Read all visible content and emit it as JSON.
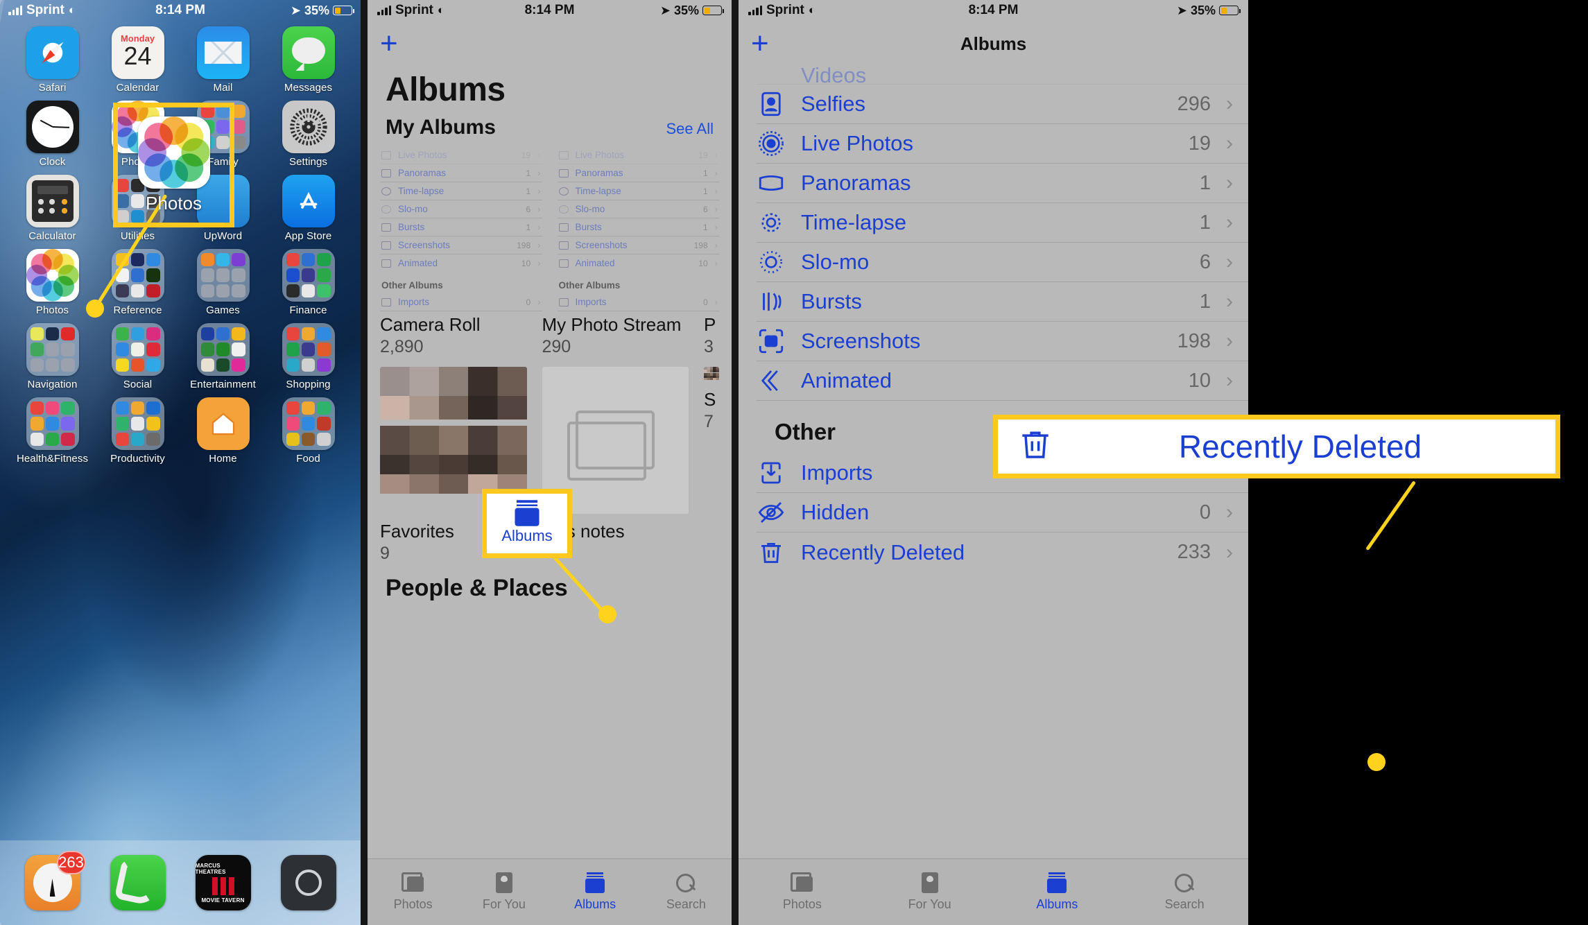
{
  "panel1": {
    "status": {
      "carrier": "Sprint",
      "time": "8:14 PM",
      "battery": "35%"
    },
    "apps": [
      {
        "label": "Safari",
        "icon": "safari-icon"
      },
      {
        "label": "Calendar",
        "icon": "calendar-icon",
        "weekday": "Monday",
        "day": "24"
      },
      {
        "label": "Mail",
        "icon": "mail-icon"
      },
      {
        "label": "Messages",
        "icon": "messages-icon"
      },
      {
        "label": "Clock",
        "icon": "clock-icon"
      },
      {
        "label": "Photos",
        "icon": "photos-icon"
      },
      {
        "label": "Family",
        "icon": "folder-icon"
      },
      {
        "label": "Settings",
        "icon": "settings-gear-icon"
      },
      {
        "label": "Calculator",
        "icon": "calculator-icon"
      },
      {
        "label": "Utilities",
        "icon": "folder-icon"
      },
      {
        "label": "UpWord",
        "icon": "upword-icon"
      },
      {
        "label": "App Store",
        "icon": "app-store-icon"
      },
      {
        "label": "Photos",
        "icon": "photos-icon"
      },
      {
        "label": "Reference",
        "icon": "folder-icon"
      },
      {
        "label": "Games",
        "icon": "folder-icon"
      },
      {
        "label": "Finance",
        "icon": "folder-icon"
      },
      {
        "label": "Navigation",
        "icon": "folder-icon"
      },
      {
        "label": "Social",
        "icon": "folder-icon"
      },
      {
        "label": "Entertainment",
        "icon": "folder-icon"
      },
      {
        "label": "Shopping",
        "icon": "folder-icon"
      },
      {
        "label": "Health&Fitness",
        "icon": "folder-icon"
      },
      {
        "label": "Productivity",
        "icon": "folder-icon"
      },
      {
        "label": "Home",
        "icon": "home-icon"
      },
      {
        "label": "Food",
        "icon": "folder-icon"
      }
    ],
    "dock": [
      {
        "label": "Podcasts",
        "icon": "podcast-icon",
        "badge": "263"
      },
      {
        "label": "Phone",
        "icon": "phone-icon"
      },
      {
        "label": "Marcus Theatres",
        "icon": "marcus-theatres-icon",
        "line1": "MARCUS THEATRES",
        "line2": "MOVIE TAVERN"
      },
      {
        "label": "Camera",
        "icon": "camera-icon"
      }
    ],
    "callout": {
      "label": "Photos"
    }
  },
  "panel2": {
    "status": {
      "carrier": "Sprint",
      "time": "8:14 PM",
      "battery": "35%"
    },
    "nav": {
      "add_label": "+"
    },
    "title": "Albums",
    "section": {
      "heading": "My Albums",
      "see_all": "See All"
    },
    "mock_rows": [
      {
        "name": "Live Photos",
        "count": "19"
      },
      {
        "name": "Panoramas",
        "count": "1"
      },
      {
        "name": "Time-lapse",
        "count": "1"
      },
      {
        "name": "Slo-mo",
        "count": "6"
      },
      {
        "name": "Bursts",
        "count": "1"
      },
      {
        "name": "Screenshots",
        "count": "198"
      },
      {
        "name": "Animated",
        "count": "10"
      }
    ],
    "other_albums_heading": "Other Albums",
    "imports_row": {
      "name": "Imports",
      "count": "0"
    },
    "cards": [
      {
        "title": "Camera Roll",
        "count": "2,890",
        "thumb": "mosaic"
      },
      {
        "title": "My Photo Stream",
        "count": "290",
        "thumb": "empty"
      },
      {
        "title": "P",
        "count": "3",
        "thumb": "mosaic"
      }
    ],
    "cards_row2": [
      {
        "title": "Favorites",
        "count": "9"
      },
      {
        "title": "tor's notes",
        "count": ""
      },
      {
        "title": "S",
        "count": "7"
      }
    ],
    "people_places": "People & Places",
    "tabs": [
      {
        "label": "Photos",
        "icon": "photos-stack-icon",
        "active": false
      },
      {
        "label": "For You",
        "icon": "for-you-icon",
        "active": false
      },
      {
        "label": "Albums",
        "icon": "albums-icon",
        "active": true
      },
      {
        "label": "Search",
        "icon": "search-icon",
        "active": false
      }
    ],
    "callout": {
      "label": "Albums"
    }
  },
  "panel3": {
    "status": {
      "carrier": "Sprint",
      "time": "8:14 PM",
      "battery": "35%"
    },
    "nav": {
      "add_label": "+",
      "title": "Albums"
    },
    "partial_row": {
      "name": "Videos"
    },
    "rows": [
      {
        "name": "Selfies",
        "count": "296",
        "icon": "selfies-icon"
      },
      {
        "name": "Live Photos",
        "count": "19",
        "icon": "live-photos-icon"
      },
      {
        "name": "Panoramas",
        "count": "1",
        "icon": "panoramas-icon"
      },
      {
        "name": "Time-lapse",
        "count": "1",
        "icon": "time-lapse-icon"
      },
      {
        "name": "Slo-mo",
        "count": "6",
        "icon": "slo-mo-icon"
      },
      {
        "name": "Bursts",
        "count": "1",
        "icon": "bursts-icon"
      },
      {
        "name": "Screenshots",
        "count": "198",
        "icon": "screenshots-icon"
      },
      {
        "name": "Animated",
        "count": "10",
        "icon": "animated-icon"
      }
    ],
    "other_heading": "Other",
    "other_rows": [
      {
        "name": "Imports",
        "count": "",
        "icon": "imports-icon"
      },
      {
        "name": "Hidden",
        "count": "0",
        "icon": "hidden-eye-icon"
      },
      {
        "name": "Recently Deleted",
        "count": "233",
        "icon": "trash-icon"
      }
    ],
    "tabs": [
      {
        "label": "Photos",
        "icon": "photos-stack-icon",
        "active": false
      },
      {
        "label": "For You",
        "icon": "for-you-icon",
        "active": false
      },
      {
        "label": "Albums",
        "icon": "albums-icon",
        "active": true
      },
      {
        "label": "Search",
        "icon": "search-icon",
        "active": false
      }
    ],
    "callout": {
      "label": "Recently Deleted"
    }
  },
  "colors": {
    "highlight": "#ffc81e",
    "leader": "#ffd21e",
    "link_blue": "#1b3fd1",
    "badge_red": "#e8362c"
  }
}
